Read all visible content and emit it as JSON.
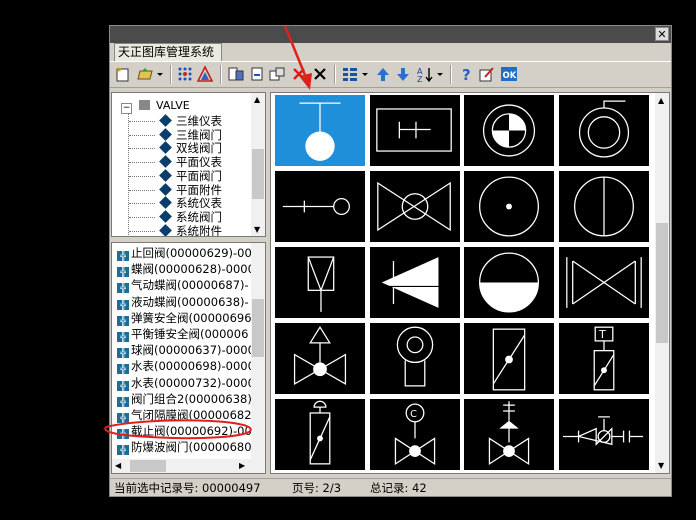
{
  "window": {
    "tab_title": "天正图库管理系统",
    "close_glyph": "✕"
  },
  "toolbar": {
    "icons": [
      "new-library-icon",
      "open-library-icon",
      "dropdown-arrow-icon",
      "grid-view-icon",
      "triangle-icon",
      "export-icon",
      "import-icon",
      "replace-icon",
      "delete-red-icon",
      "delete-icon",
      "view-mode-icon",
      "dropdown-arrow-icon",
      "move-up-icon",
      "move-down-icon",
      "sort-icon",
      "dropdown-arrow-icon",
      "help-icon",
      "edit-icon",
      "ok-icon"
    ]
  },
  "tree": {
    "root": "VALVE",
    "items": [
      "三维仪表",
      "三维阀门",
      "双线阀门",
      "平面仪表",
      "平面阀门",
      "平面附件",
      "系统仪表",
      "系统阀门",
      "系统附件"
    ]
  },
  "list": {
    "items": [
      "止回阀(00000629)-00",
      "蝶阀(00000628)-0000",
      "气动蝶阀(00000687)-",
      "液动蝶阀(00000638)-",
      "弹簧安全阀(00000696",
      "平衡锤安全阀(000006",
      "球阀(00000637)-0000",
      "水表(00000698)-0000",
      "水表(00000732)-0000",
      "阀门组合2(00000638)",
      "气闭隔膜阀(00000682",
      "截止阀(00000692)-00",
      "防爆波阀门(00000680"
    ]
  },
  "status": {
    "record_label": "当前选中记录号: 00000497",
    "page_label": "页号: 2/3",
    "total_label": "总记录:  42"
  },
  "colors": {
    "selected_cell": "#1e8fd8",
    "annotation_red": "#e0201a",
    "window_bg": "#d4d0c8"
  }
}
